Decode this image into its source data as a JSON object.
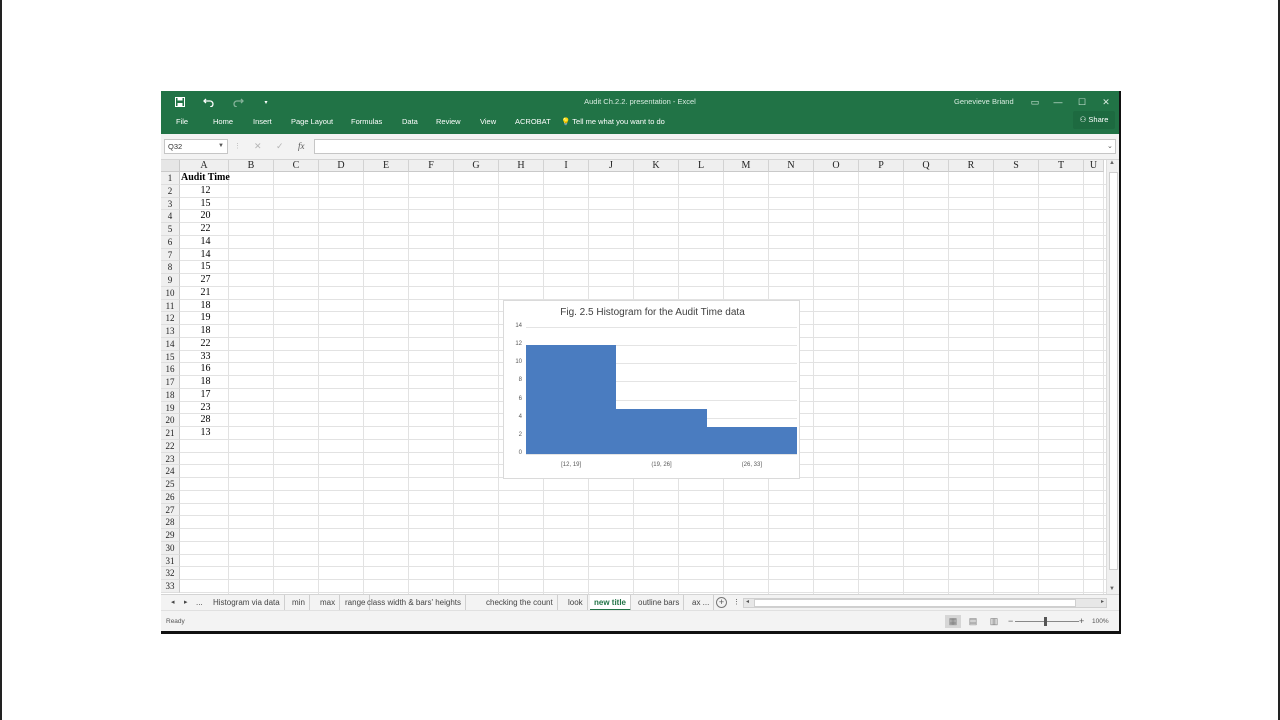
{
  "window": {
    "title": "Audit Ch.2.2. presentation  -  Excel",
    "user": "Genevieve Briand",
    "controls": {
      "ribbon_options": "▭",
      "minimize": "—",
      "maximize": "☐",
      "close": "✕"
    }
  },
  "quick_access": {
    "save_icon": "save-icon",
    "undo_icon": "undo-icon",
    "redo_icon": "redo-icon",
    "customize_icon": "dropdown-icon"
  },
  "ribbon": {
    "tabs": [
      "File",
      "Home",
      "Insert",
      "Page Layout",
      "Formulas",
      "Data",
      "Review",
      "View",
      "ACROBAT"
    ],
    "tell_me": "Tell me what you want to do",
    "share": "Share"
  },
  "formula_bar": {
    "name_box": "Q32",
    "cancel": "✕",
    "enter": "✓",
    "fx": "fx",
    "formula": ""
  },
  "sheet": {
    "columns": [
      "A",
      "B",
      "C",
      "D",
      "E",
      "F",
      "G",
      "H",
      "I",
      "J",
      "K",
      "L",
      "M",
      "N",
      "O",
      "P",
      "Q",
      "R",
      "S",
      "T",
      "U"
    ],
    "row_numbers": [
      "1",
      "2",
      "3",
      "4",
      "5",
      "6",
      "7",
      "8",
      "9",
      "10",
      "11",
      "12",
      "13",
      "14",
      "15",
      "16",
      "17",
      "18",
      "19",
      "20",
      "21",
      "22",
      "23",
      "24",
      "25",
      "26",
      "27",
      "28",
      "29",
      "30",
      "31",
      "32",
      "33"
    ],
    "header": "Audit Time",
    "values": [
      "12",
      "15",
      "20",
      "22",
      "14",
      "14",
      "15",
      "27",
      "21",
      "18",
      "19",
      "18",
      "22",
      "33",
      "16",
      "18",
      "17",
      "23",
      "28",
      "13"
    ]
  },
  "chart_data": {
    "type": "bar",
    "title": "Fig. 2.5 Histogram for the Audit Time data",
    "categories": [
      "[12, 19]",
      "(19, 26]",
      "(26, 33]"
    ],
    "values": [
      12,
      5,
      3
    ],
    "ylim": [
      0,
      14
    ],
    "yticks": [
      "0",
      "2",
      "4",
      "6",
      "8",
      "10",
      "12",
      "14"
    ],
    "bar_color": "#4a7cc0",
    "gap_width": 0,
    "grid": true,
    "legend": "none"
  },
  "sheet_tabs": {
    "nav_prev": "◂",
    "nav_next": "▸",
    "more_left": "...",
    "tabs": [
      "Histogram via data",
      "min",
      "max",
      "range",
      "class width & bars' heights",
      "checking the count",
      "look",
      "new title",
      "outline bars",
      "ax ..."
    ],
    "active": "new title",
    "add": "+"
  },
  "status": {
    "text": "Ready",
    "zoom": "100%"
  },
  "colors": {
    "excel_green": "#217346",
    "bar_blue": "#4a7cc0"
  }
}
